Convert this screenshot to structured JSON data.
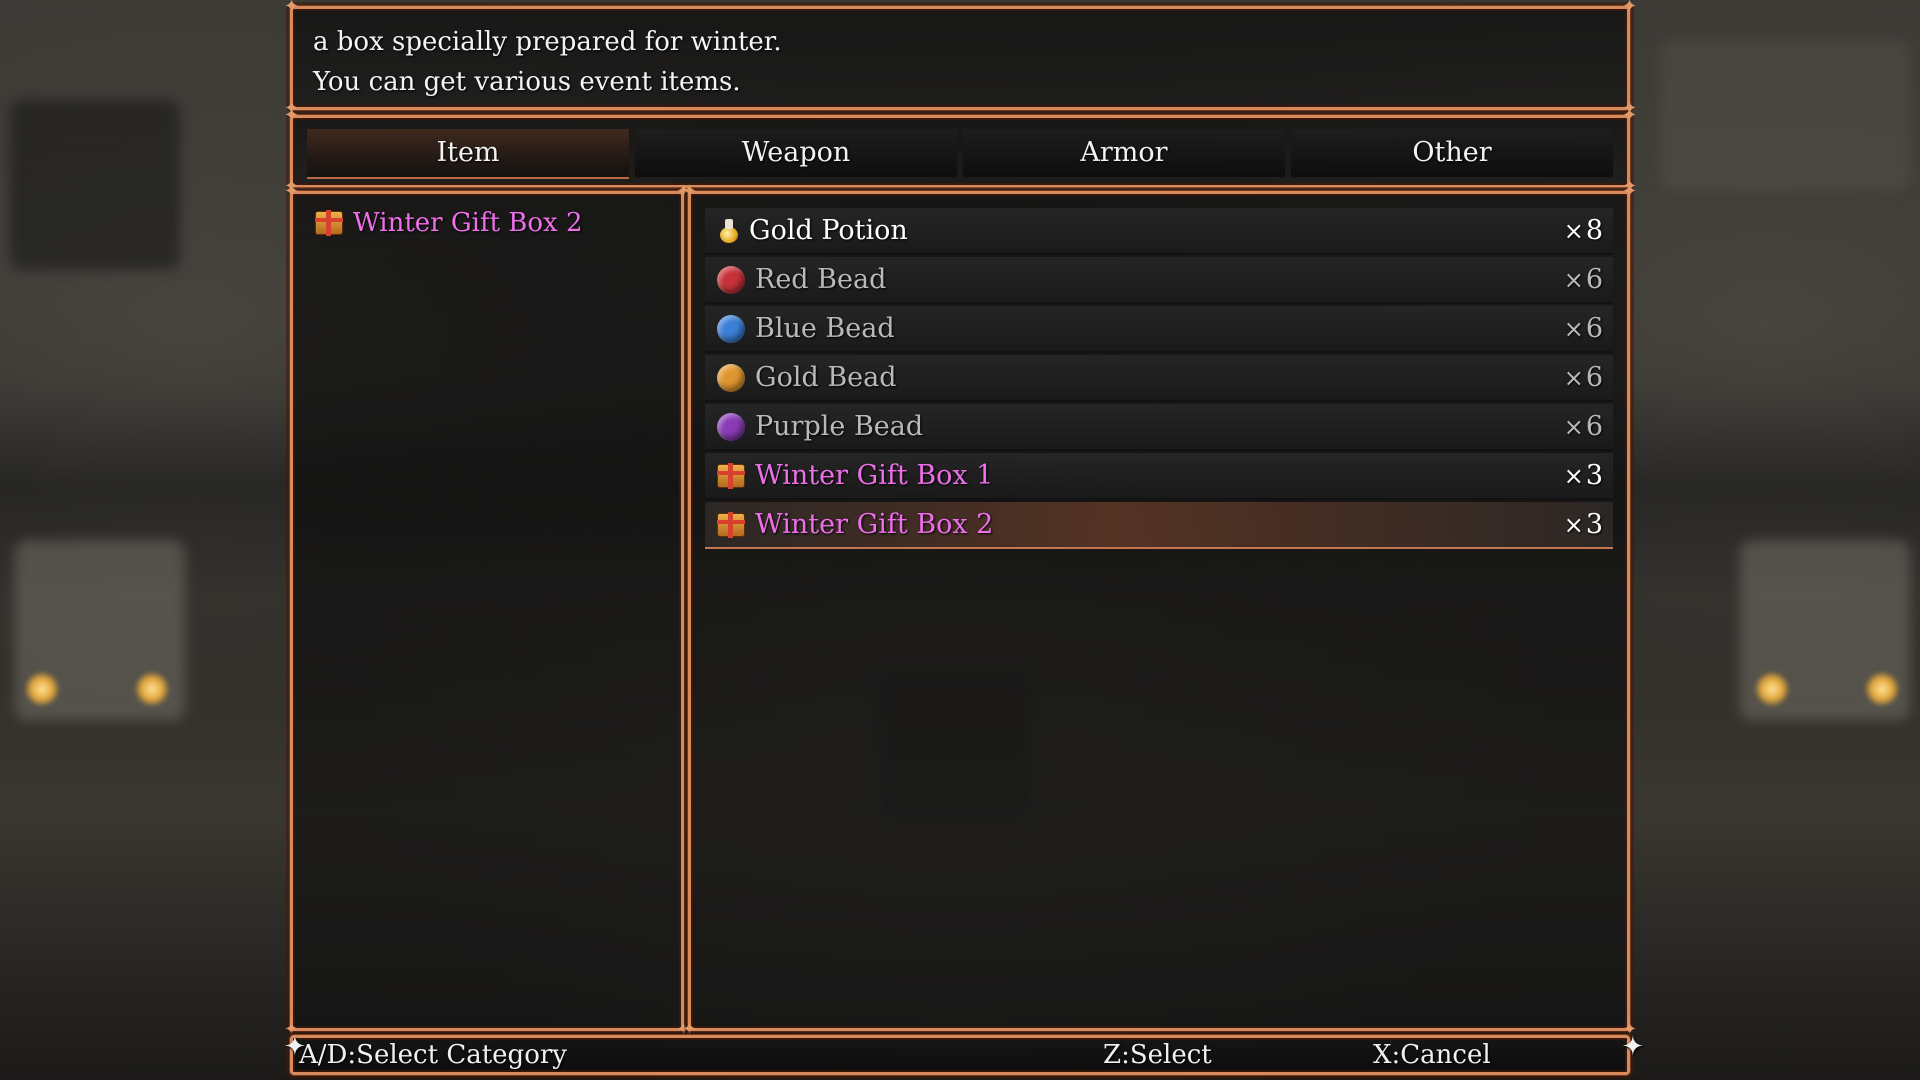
{
  "help": {
    "line1": "a box specially prepared for winter.",
    "line2": "You can get various event items."
  },
  "tabs": [
    {
      "label": "Item",
      "active": true
    },
    {
      "label": "Weapon",
      "active": false
    },
    {
      "label": "Armor",
      "active": false
    },
    {
      "label": "Other",
      "active": false
    }
  ],
  "left_list": {
    "selected_item": {
      "icon": "gift-box-icon",
      "label": "Winter Gift Box 2"
    }
  },
  "items": [
    {
      "icon": "gold-potion-icon",
      "name": "Gold Potion",
      "qty_symbol": "×",
      "qty": "8"
    },
    {
      "icon": "red-bead-icon",
      "name": "Red Bead",
      "qty_symbol": "×",
      "qty": "6",
      "bead_color": "#c8323a"
    },
    {
      "icon": "blue-bead-icon",
      "name": "Blue Bead",
      "qty_symbol": "×",
      "qty": "6",
      "bead_color": "#3b7fd6"
    },
    {
      "icon": "gold-bead-icon",
      "name": "Gold Bead",
      "qty_symbol": "×",
      "qty": "6",
      "bead_color": "#e0962e"
    },
    {
      "icon": "purple-bead-icon",
      "name": "Purple Bead",
      "qty_symbol": "×",
      "qty": "6",
      "bead_color": "#8a3bb5"
    },
    {
      "icon": "gift-box-icon",
      "name": "Winter Gift Box 1",
      "qty_symbol": "×",
      "qty": "3"
    },
    {
      "icon": "gift-box-icon",
      "name": "Winter Gift Box 2",
      "qty_symbol": "×",
      "qty": "3"
    }
  ],
  "footer": {
    "category_hint": "A/D:Select Category",
    "select_hint": "Z:Select",
    "cancel_hint": "X:Cancel"
  },
  "colors": {
    "frame": "#d98a5c",
    "highlight_text": "#ee6fe9",
    "dim_text": "#b9b9b9"
  }
}
